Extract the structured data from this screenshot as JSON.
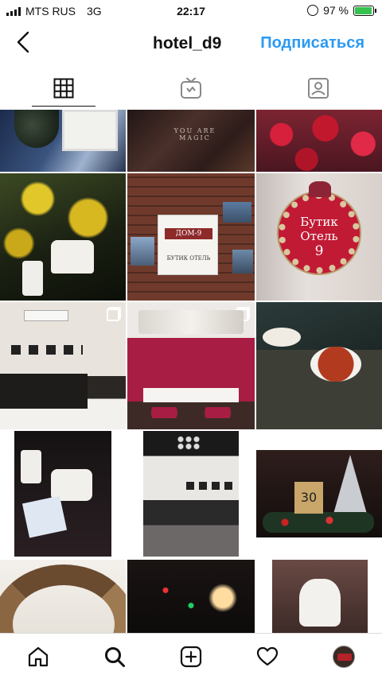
{
  "status": {
    "carrier": "MTS RUS",
    "network": "3G",
    "time": "22:17",
    "battery": "97 %",
    "battery_level": 0.97
  },
  "header": {
    "title": "hotel_d9",
    "follow_label": "Подписаться",
    "follow_color": "#2b9af3"
  },
  "tabs": [
    {
      "icon": "grid-icon",
      "active": true
    },
    {
      "icon": "igtv-icon",
      "active": false
    },
    {
      "icon": "tagged-icon",
      "active": false
    }
  ],
  "posts": {
    "sign_dom9_top": "ДОМ-9",
    "sign_dom9_bottom": "БУТИК ОТЕЛЬ",
    "wreath_line1": "Бутик",
    "wreath_line2": "Отель",
    "wreath_line3": "9",
    "calendar_number": "30",
    "neon_text": "YOU ARE MAGIC"
  },
  "bottom_nav": [
    {
      "icon": "home-icon"
    },
    {
      "icon": "search-icon"
    },
    {
      "icon": "new-post-icon"
    },
    {
      "icon": "activity-heart-icon"
    },
    {
      "icon": "profile-avatar"
    }
  ]
}
